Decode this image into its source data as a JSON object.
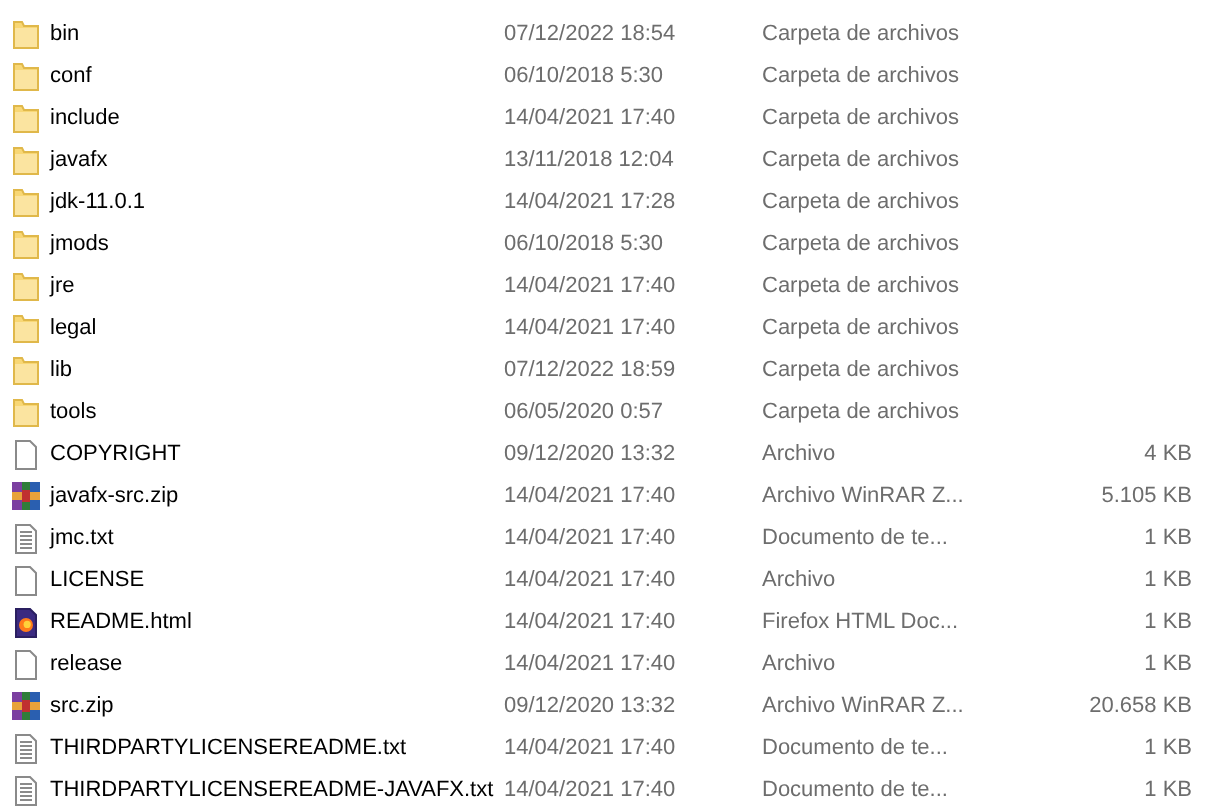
{
  "files": [
    {
      "kind": "folder",
      "name": "bin",
      "date": "07/12/2022 18:54",
      "type": "Carpeta de archivos"
    },
    {
      "kind": "folder",
      "name": "conf",
      "date": "06/10/2018 5:30",
      "type": "Carpeta de archivos"
    },
    {
      "kind": "folder",
      "name": "include",
      "date": "14/04/2021 17:40",
      "type": "Carpeta de archivos"
    },
    {
      "kind": "folder",
      "name": "javafx",
      "date": "13/11/2018 12:04",
      "type": "Carpeta de archivos"
    },
    {
      "kind": "folder",
      "name": "jdk-11.0.1",
      "date": "14/04/2021 17:28",
      "type": "Carpeta de archivos"
    },
    {
      "kind": "folder",
      "name": "jmods",
      "date": "06/10/2018 5:30",
      "type": "Carpeta de archivos"
    },
    {
      "kind": "folder",
      "name": "jre",
      "date": "14/04/2021 17:40",
      "type": "Carpeta de archivos"
    },
    {
      "kind": "folder",
      "name": "legal",
      "date": "14/04/2021 17:40",
      "type": "Carpeta de archivos"
    },
    {
      "kind": "folder",
      "name": "lib",
      "date": "07/12/2022 18:59",
      "type": "Carpeta de archivos"
    },
    {
      "kind": "folder",
      "name": "tools",
      "date": "06/05/2020 0:57",
      "type": "Carpeta de archivos"
    },
    {
      "kind": "file",
      "name": "COPYRIGHT",
      "date": "09/12/2020 13:32",
      "type": "Archivo",
      "size": "4 KB"
    },
    {
      "kind": "archive",
      "name": "javafx-src.zip",
      "date": "14/04/2021 17:40",
      "type": "Archivo WinRAR Z...",
      "size": "5.105 KB"
    },
    {
      "kind": "text",
      "name": "jmc.txt",
      "date": "14/04/2021 17:40",
      "type": "Documento de te...",
      "size": "1 KB"
    },
    {
      "kind": "file",
      "name": "LICENSE",
      "date": "14/04/2021 17:40",
      "type": "Archivo",
      "size": "1 KB"
    },
    {
      "kind": "html",
      "name": "README.html",
      "date": "14/04/2021 17:40",
      "type": "Firefox HTML Doc...",
      "size": "1 KB"
    },
    {
      "kind": "file",
      "name": "release",
      "date": "14/04/2021 17:40",
      "type": "Archivo",
      "size": "1 KB"
    },
    {
      "kind": "archive",
      "name": "src.zip",
      "date": "09/12/2020 13:32",
      "type": "Archivo WinRAR Z...",
      "size": "20.658 KB"
    },
    {
      "kind": "text",
      "name": "THIRDPARTYLICENSEREADME.txt",
      "date": "14/04/2021 17:40",
      "type": "Documento de te...",
      "size": "1 KB"
    },
    {
      "kind": "text",
      "name": "THIRDPARTYLICENSEREADME-JAVAFX.txt",
      "date": "14/04/2021 17:40",
      "type": "Documento de te...",
      "size": "1 KB"
    }
  ]
}
